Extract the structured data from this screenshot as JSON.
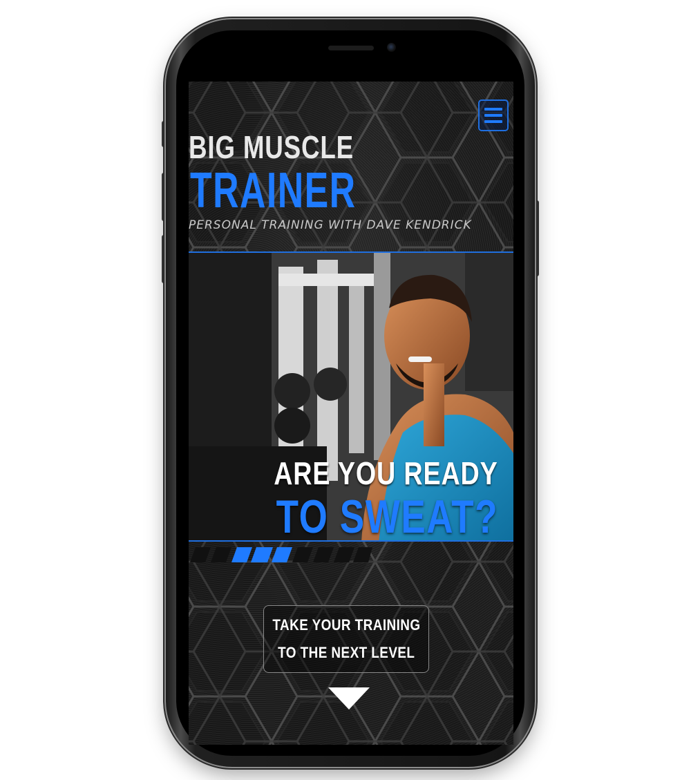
{
  "header": {
    "logo_line1": "BIG MUSCLE",
    "logo_line2": "TRAINER",
    "tagline": "PERSONAL TRAINING WITH DAVE KENDRICK",
    "menu_icon": "hamburger-menu-icon"
  },
  "hero": {
    "headline_line1": "ARE YOU READY",
    "headline_line2": "TO SWEAT?"
  },
  "cta": {
    "line1": "TAKE YOUR TRAINING",
    "line2": "TO THE NEXT LEVEL",
    "scroll_icon": "down-arrow-icon"
  },
  "colors": {
    "accent": "#1f7bff",
    "background": "#1d1d1d",
    "text": "#ffffff"
  }
}
